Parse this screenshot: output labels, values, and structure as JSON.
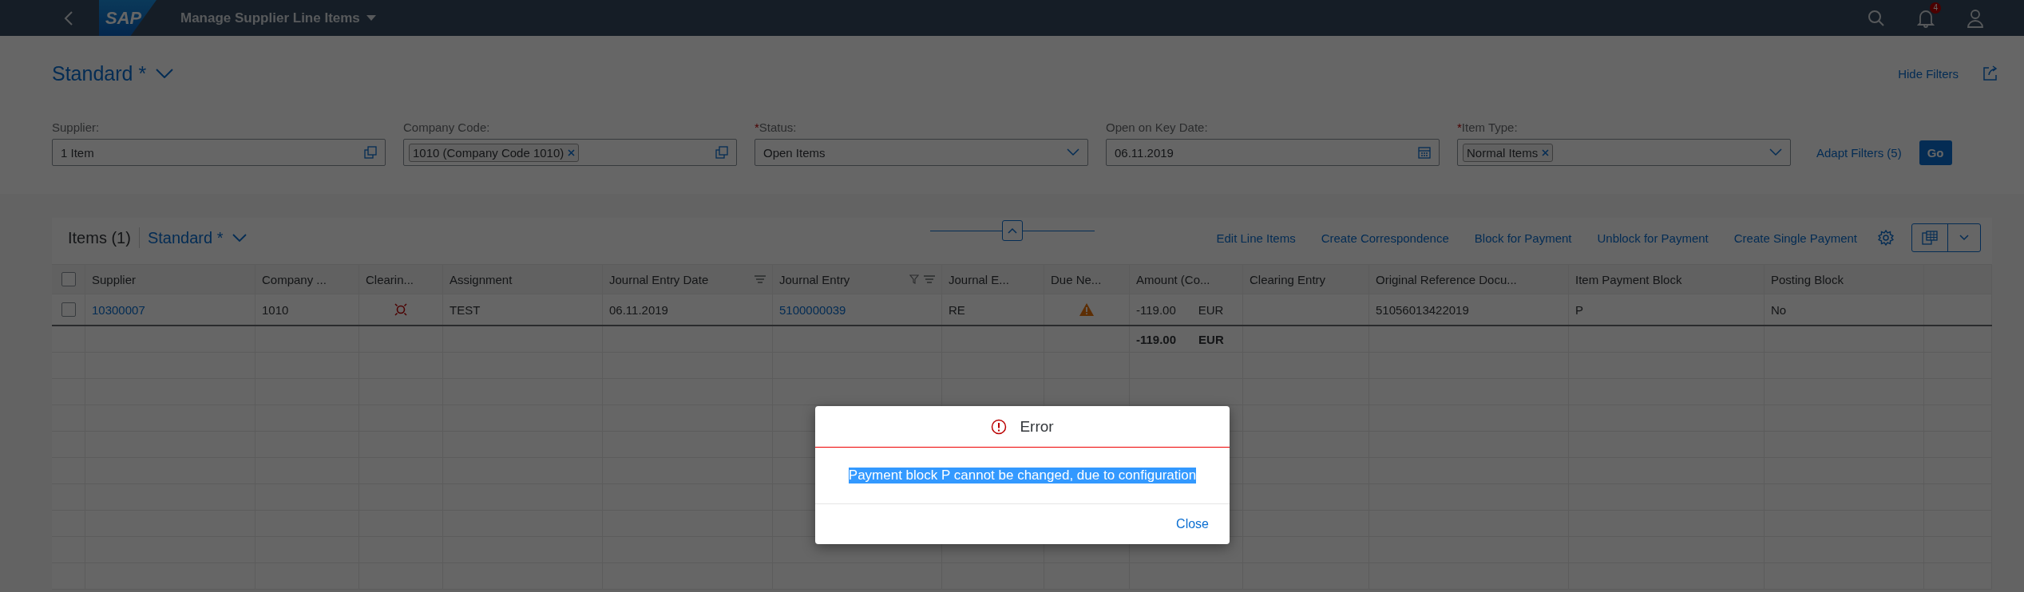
{
  "shell": {
    "logo": "SAP",
    "title": "Manage Supplier Line Items",
    "notification_count": "4"
  },
  "variant": "Standard *",
  "hide_filters": "Hide Filters",
  "filters": [
    {
      "label": "Supplier:",
      "kind": "value_help",
      "value": "1 Item"
    },
    {
      "label": "Company Code:",
      "kind": "value_help",
      "tokens": [
        "1010 (Company Code 1010)"
      ]
    },
    {
      "label": "Status:",
      "required_mark": "*",
      "kind": "select",
      "value": "Open Items"
    },
    {
      "label": "Open on Key Date:",
      "kind": "date",
      "value": "06.11.2019"
    },
    {
      "label": "Item Type:",
      "required_mark": "*",
      "kind": "select",
      "tokens": [
        "Normal Items"
      ]
    }
  ],
  "adapt_filters": "Adapt Filters (5)",
  "go": "Go",
  "table": {
    "title": "Items (1)",
    "variant": "Standard *",
    "all_selected": false,
    "actions": [
      "Edit Line Items",
      "Create Correspondence",
      "Block for Payment",
      "Unblock for Payment",
      "Create Single Payment"
    ],
    "columns": [
      {
        "label": "Supplier",
        "sorted": false,
        "filtered": false
      },
      {
        "label": "Company ...",
        "sorted": false,
        "filtered": false
      },
      {
        "label": "Clearin...",
        "sorted": false,
        "filtered": false
      },
      {
        "label": "Assignment",
        "sorted": false,
        "filtered": false
      },
      {
        "label": "Journal Entry Date",
        "sorted": true,
        "filtered": false
      },
      {
        "label": "Journal Entry",
        "sorted": true,
        "filtered": true
      },
      {
        "label": "Journal E...",
        "sorted": false,
        "filtered": false
      },
      {
        "label": "Due Ne...",
        "sorted": false,
        "filtered": false
      },
      {
        "label": "Amount (Co...",
        "sorted": false,
        "filtered": false
      },
      {
        "label": "Clearing Entry",
        "sorted": false,
        "filtered": false
      },
      {
        "label": "Original Reference Docu...",
        "sorted": false,
        "filtered": false
      },
      {
        "label": "Item Payment Block",
        "sorted": false,
        "filtered": false
      },
      {
        "label": "Posting Block",
        "sorted": false,
        "filtered": false
      }
    ],
    "rows": [
      {
        "selected": false,
        "cells": [
          {
            "kind": "link",
            "text": "10300007"
          },
          {
            "kind": "text",
            "text": "1010"
          },
          {
            "kind": "clearing_status"
          },
          {
            "kind": "text",
            "text": "TEST"
          },
          {
            "kind": "text",
            "text": "06.11.2019"
          },
          {
            "kind": "link",
            "text": "5100000039"
          },
          {
            "kind": "text",
            "text": "RE"
          },
          {
            "kind": "due_warning"
          },
          {
            "kind": "amount",
            "text": "-119.00",
            "unit": "EUR"
          },
          {
            "kind": "empty"
          },
          {
            "kind": "text",
            "text": "51056013422019"
          },
          {
            "kind": "text",
            "text": "P"
          },
          {
            "kind": "text",
            "text": "No"
          }
        ]
      }
    ],
    "total": {
      "cells": [
        {
          "kind": "empty"
        },
        {
          "kind": "empty"
        },
        {
          "kind": "empty"
        },
        {
          "kind": "empty"
        },
        {
          "kind": "empty"
        },
        {
          "kind": "empty"
        },
        {
          "kind": "empty"
        },
        {
          "kind": "empty"
        },
        {
          "kind": "amount",
          "text": "-119.00",
          "unit": "EUR"
        },
        {
          "kind": "empty"
        },
        {
          "kind": "empty"
        },
        {
          "kind": "empty"
        },
        {
          "kind": "empty"
        }
      ]
    }
  },
  "dialog": {
    "title": "Error",
    "message": "Payment block P cannot be changed, due to configuration",
    "message_selected": true,
    "button": "Close"
  }
}
